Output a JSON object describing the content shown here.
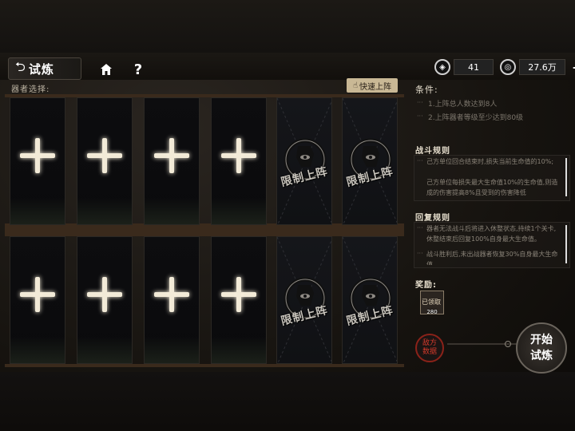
{
  "header": {
    "back_title": "试炼",
    "home_icon": "home-icon",
    "help_label": "?"
  },
  "resources": [
    {
      "icon": "diamond-icon",
      "value": "41",
      "add": "+"
    },
    {
      "icon": "coin-icon",
      "value": "27.6万",
      "add": "+"
    }
  ],
  "selection": {
    "label": "器者选择:",
    "quick_button": "快速上阵",
    "slots": [
      {
        "state": "open"
      },
      {
        "state": "open"
      },
      {
        "state": "open"
      },
      {
        "state": "open"
      },
      {
        "state": "locked",
        "label": "限制上阵"
      },
      {
        "state": "locked",
        "label": "限制上阵"
      },
      {
        "state": "open"
      },
      {
        "state": "open"
      },
      {
        "state": "open"
      },
      {
        "state": "open"
      },
      {
        "state": "locked",
        "label": "限制上阵"
      },
      {
        "state": "locked",
        "label": "限制上阵"
      }
    ]
  },
  "conditions": {
    "title": "条件:",
    "items": [
      "1.上阵总人数达到8人",
      "2.上阵器者等级至少达到80级"
    ]
  },
  "battle_rules": {
    "title": "战斗规则",
    "items": [
      "己方单位回合结束时,损失当前生命值的10%;",
      "己方单位每损失最大生命值10%的生命值,则造成的伤害提高8%且受到的伤害降低"
    ]
  },
  "recovery_rules": {
    "title": "回复规则",
    "items": [
      "器者无法战斗后将进入休整状态,持续1个关卡,休整结束后回复100%自身最大生命值。",
      "战斗胜利后,未出战器者恢复30%自身最大生命值。"
    ]
  },
  "rewards": {
    "title": "奖励:",
    "items": [
      {
        "glyph": "已领取",
        "count": "280"
      }
    ]
  },
  "seal_button": "敌方数据",
  "start_button": "开始试炼",
  "colors": {
    "accent": "#c9b895",
    "seal": "#8b2219"
  }
}
